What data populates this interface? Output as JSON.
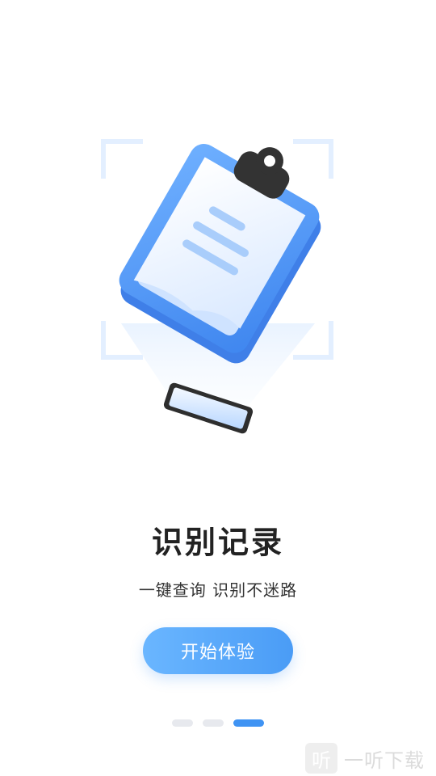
{
  "onboarding": {
    "title": "识别记录",
    "subtitle": "一键查询 识别不迷路",
    "start_button_label": "开始体验",
    "pager": {
      "total_pages": 3,
      "current_page": 3
    }
  },
  "watermark": {
    "logo_glyph": "听",
    "text": "一听下载"
  },
  "colors": {
    "accent": "#3f93f3",
    "button_gradient_start": "#6ab6ff",
    "button_gradient_end": "#4a9cf6",
    "clipboard_blue": "#5b9cf5",
    "title_text": "#222222"
  },
  "icons": {
    "illustration": "clipboard-scan-illustration"
  }
}
